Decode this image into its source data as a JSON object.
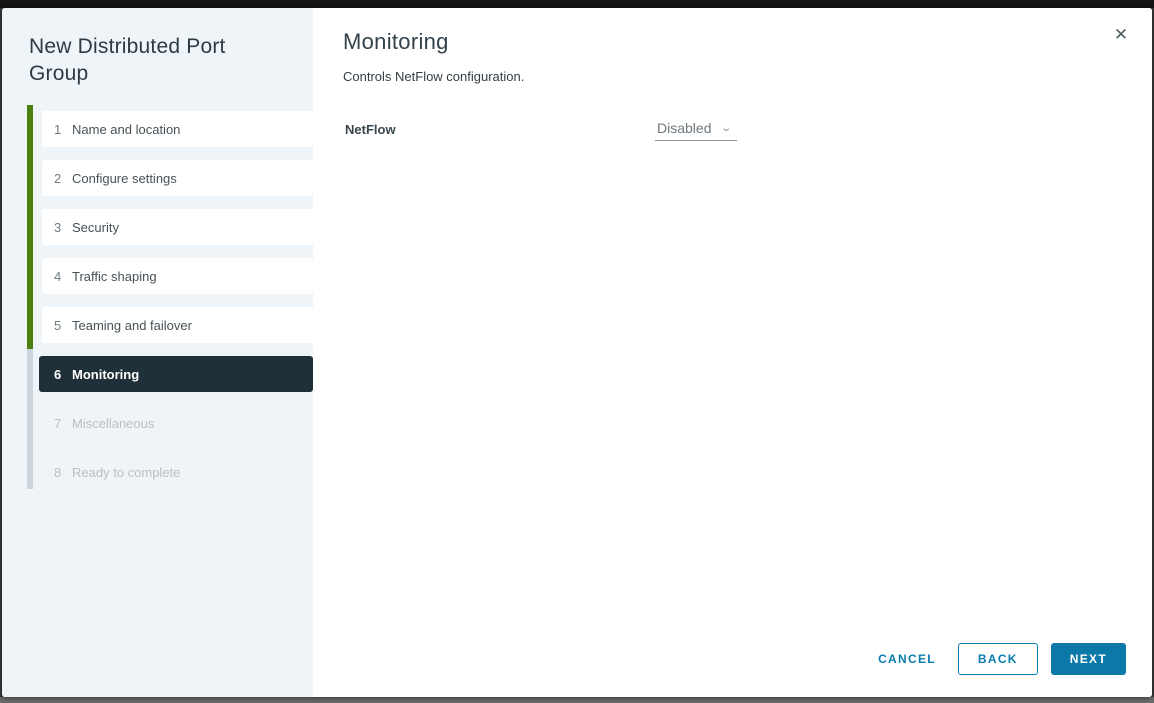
{
  "colors": {
    "accent": "#0a7cad",
    "primary_btn": "#0b79a8",
    "green": "#4e8010",
    "active_bg": "#1f3038",
    "sidebar_bg": "#eef4f8",
    "rail_gray": "#ccd5db"
  },
  "wizard": {
    "title": "New Distributed Port Group",
    "close_icon": "✕",
    "steps": [
      {
        "number": "1",
        "label": "Name and location",
        "state": "done"
      },
      {
        "number": "2",
        "label": "Configure settings",
        "state": "done"
      },
      {
        "number": "3",
        "label": "Security",
        "state": "done"
      },
      {
        "number": "4",
        "label": "Traffic shaping",
        "state": "done"
      },
      {
        "number": "5",
        "label": "Teaming and failover",
        "state": "done"
      },
      {
        "number": "6",
        "label": "Monitoring",
        "state": "active"
      },
      {
        "number": "7",
        "label": "Miscellaneous",
        "state": "upcoming"
      },
      {
        "number": "8",
        "label": "Ready to complete",
        "state": "upcoming"
      }
    ]
  },
  "content": {
    "title": "Monitoring",
    "description": "Controls NetFlow configuration.",
    "field": {
      "label": "NetFlow",
      "value": "Disabled",
      "caret": "⌄"
    }
  },
  "footer": {
    "cancel": "CANCEL",
    "back": "BACK",
    "next": "NEXT"
  }
}
